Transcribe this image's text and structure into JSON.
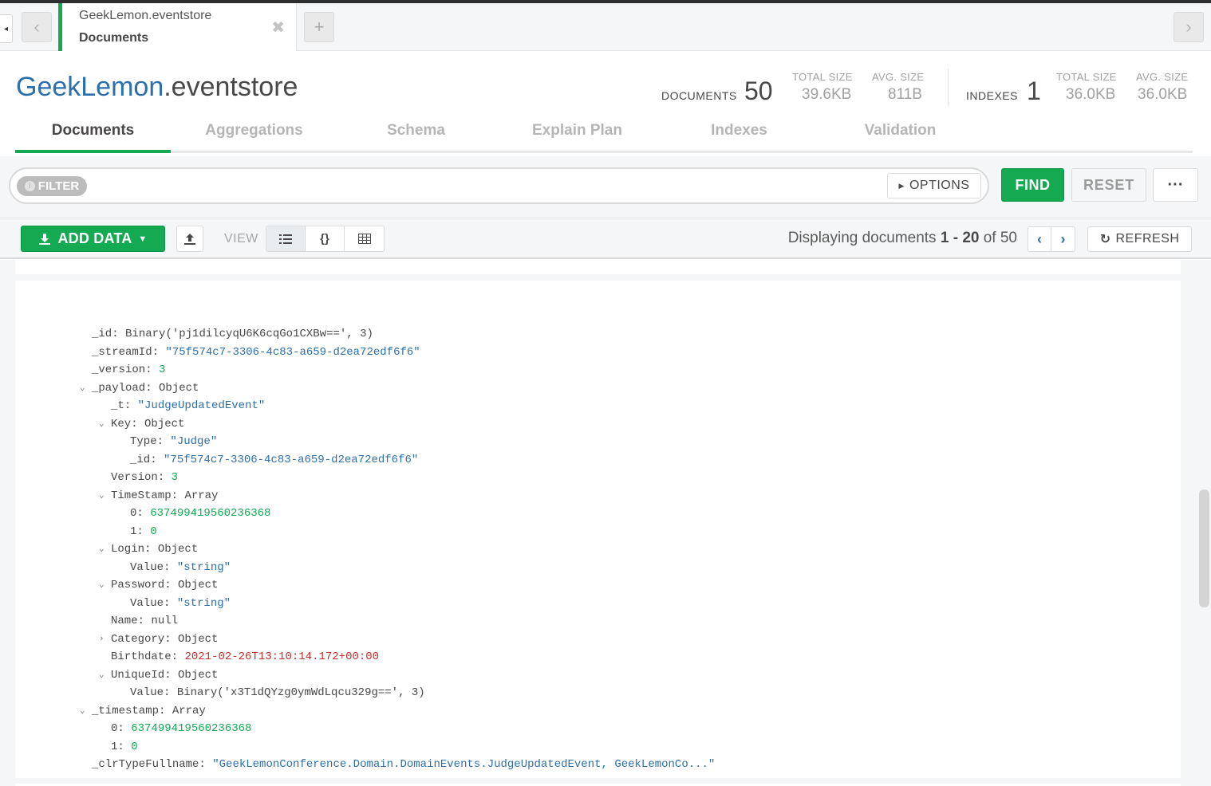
{
  "tabbar": {
    "tab_title": "GeekLemon.eventstore",
    "tab_subtitle": "Documents",
    "close_glyph": "✖",
    "new_tab_glyph": "+",
    "back_glyph": "‹",
    "forward_glyph": "›",
    "collapse_glyph": "◂"
  },
  "header": {
    "db": "GeekLemon",
    "collection": ".eventstore",
    "documents_label": "DOCUMENTS",
    "documents_count": "50",
    "doc_total_size_label": "TOTAL SIZE",
    "doc_total_size": "39.6KB",
    "doc_avg_size_label": "AVG. SIZE",
    "doc_avg_size": "811B",
    "indexes_label": "INDEXES",
    "indexes_count": "1",
    "idx_total_size_label": "TOTAL SIZE",
    "idx_total_size": "36.0KB",
    "idx_avg_size_label": "AVG. SIZE",
    "idx_avg_size": "36.0KB"
  },
  "subtabs": [
    "Documents",
    "Aggregations",
    "Schema",
    "Explain Plan",
    "Indexes",
    "Validation"
  ],
  "filter": {
    "pill": "FILTER",
    "options": "OPTIONS",
    "find": "FIND",
    "reset": "RESET",
    "more": "···"
  },
  "toolbar": {
    "add_data": "ADD DATA",
    "view_label": "VIEW",
    "display_prefix": "Displaying documents ",
    "display_start": "1",
    "display_sep": " - ",
    "display_end": "20",
    "display_of": " of 50",
    "refresh": "REFRESH"
  },
  "document": [
    {
      "indent": 0,
      "caret": "",
      "key": "_id",
      "value": "Binary('pj1dilcyqU6K6cqGo1CXBw==', 3)",
      "type": "o"
    },
    {
      "indent": 0,
      "caret": "",
      "key": "_streamId",
      "value": "\"75f574c7-3306-4c83-a659-d2ea72edf6f6\"",
      "type": "s"
    },
    {
      "indent": 0,
      "caret": "",
      "key": "_version",
      "value": "3",
      "type": "n"
    },
    {
      "indent": 0,
      "caret": "⌄",
      "key": "_payload",
      "value": "Object",
      "type": "o"
    },
    {
      "indent": 1,
      "caret": "",
      "key": "_t",
      "value": "\"JudgeUpdatedEvent\"",
      "type": "s"
    },
    {
      "indent": 1,
      "caret": "⌄",
      "key": "Key",
      "value": "Object",
      "type": "o"
    },
    {
      "indent": 2,
      "caret": "",
      "key": "Type",
      "value": "\"Judge\"",
      "type": "s"
    },
    {
      "indent": 2,
      "caret": "",
      "key": "_id",
      "value": "\"75f574c7-3306-4c83-a659-d2ea72edf6f6\"",
      "type": "s"
    },
    {
      "indent": 1,
      "caret": "",
      "key": "Version",
      "value": "3",
      "type": "n"
    },
    {
      "indent": 1,
      "caret": "⌄",
      "key": "TimeStamp",
      "value": "Array",
      "type": "o"
    },
    {
      "indent": 2,
      "caret": "",
      "key": "0",
      "value": "637499419560236368",
      "type": "n"
    },
    {
      "indent": 2,
      "caret": "",
      "key": "1",
      "value": "0",
      "type": "n"
    },
    {
      "indent": 1,
      "caret": "⌄",
      "key": "Login",
      "value": "Object",
      "type": "o"
    },
    {
      "indent": 2,
      "caret": "",
      "key": "Value",
      "value": "\"string\"",
      "type": "s"
    },
    {
      "indent": 1,
      "caret": "⌄",
      "key": "Password",
      "value": "Object",
      "type": "o"
    },
    {
      "indent": 2,
      "caret": "",
      "key": "Value",
      "value": "\"string\"",
      "type": "s"
    },
    {
      "indent": 1,
      "caret": "",
      "key": "Name",
      "value": "null",
      "type": "o"
    },
    {
      "indent": 1,
      "caret": "›",
      "key": "Category",
      "value": "Object",
      "type": "o"
    },
    {
      "indent": 1,
      "caret": "",
      "key": "Birthdate",
      "value": "2021-02-26T13:10:14.172+00:00",
      "type": "d"
    },
    {
      "indent": 1,
      "caret": "⌄",
      "key": "UniqueId",
      "value": "Object",
      "type": "o"
    },
    {
      "indent": 2,
      "caret": "",
      "key": "Value",
      "value": "Binary('x3T1dQYzg0ymWdLqcu329g==', 3)",
      "type": "o"
    },
    {
      "indent": 0,
      "caret": "⌄",
      "key": "_timestamp",
      "value": "Array",
      "type": "o"
    },
    {
      "indent": 1,
      "caret": "",
      "key": "0",
      "value": "637499419560236368",
      "type": "n"
    },
    {
      "indent": 1,
      "caret": "",
      "key": "1",
      "value": "0",
      "type": "n"
    },
    {
      "indent": 0,
      "caret": "",
      "key": "_clrTypeFullname",
      "value": "\"GeekLemonConference.Domain.DomainEvents.JudgeUpdatedEvent, GeekLemonCo...\"",
      "type": "s"
    }
  ]
}
